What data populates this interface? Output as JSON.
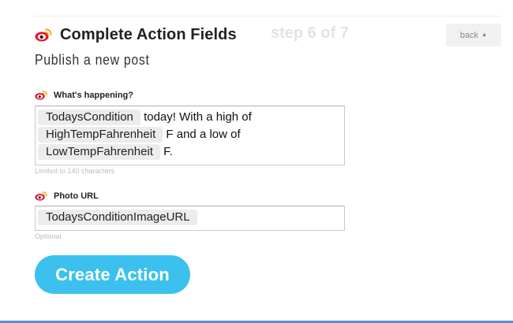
{
  "header": {
    "title": "Complete Action Fields",
    "step": "step 6 of 7",
    "back_label": "back",
    "subtitle": "Publish a new post"
  },
  "fields": {
    "status": {
      "label": "What's happening?",
      "line1_pill": "TodaysCondition",
      "line1_text": " today! With a high of",
      "line2_pill": "HighTempFahrenheit",
      "line2_text": " F and a low of",
      "line3_pill": "LowTempFahrenheit",
      "line3_text": " F.",
      "hint": "Limited to 140 characters"
    },
    "photo": {
      "label": "Photo URL",
      "pill": "TodaysConditionImageURL",
      "hint": "Optional"
    }
  },
  "actions": {
    "create_label": "Create Action"
  },
  "icons": {
    "service": "weibo-icon",
    "back_caret": "caret-up-icon"
  },
  "colors": {
    "accent": "#3cc1ee",
    "weibo_red": "#e6162d",
    "weibo_orange": "#f5a623",
    "bottom_bar": "#5b8fc7"
  }
}
